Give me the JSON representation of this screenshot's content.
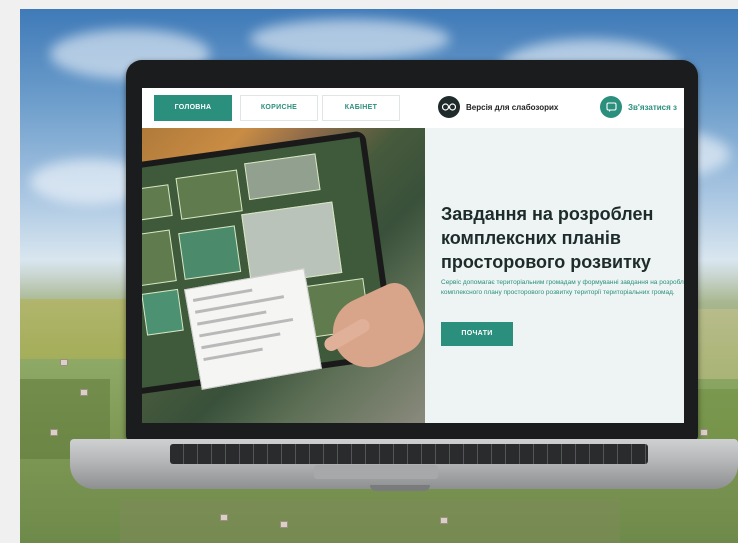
{
  "nav": {
    "tabs": [
      {
        "label": "ГОЛОВНА",
        "active": true
      },
      {
        "label": "КОРИСНЕ",
        "active": false
      },
      {
        "label": "КАБІНЕТ",
        "active": false
      }
    ],
    "vision_label": "Версія для слабозорих",
    "vision_icon": "glasses-icon",
    "contact_label": "Зв'язатися з",
    "contact_icon": "chat-icon"
  },
  "hero": {
    "title_line1": "Завдання на розроблен",
    "title_line2": "комплексних планів",
    "title_line3": "просторового розвитку",
    "description": "Сервіс допомагає територіальним громадам у формуванні завдання на розроблення комплексного плану просторового розвитку території територіальних громад.",
    "button_label": "ПОЧАТИ"
  },
  "colors": {
    "accent": "#2b8f7d",
    "panel_bg": "#eef4f3",
    "title": "#1d2b2b"
  }
}
